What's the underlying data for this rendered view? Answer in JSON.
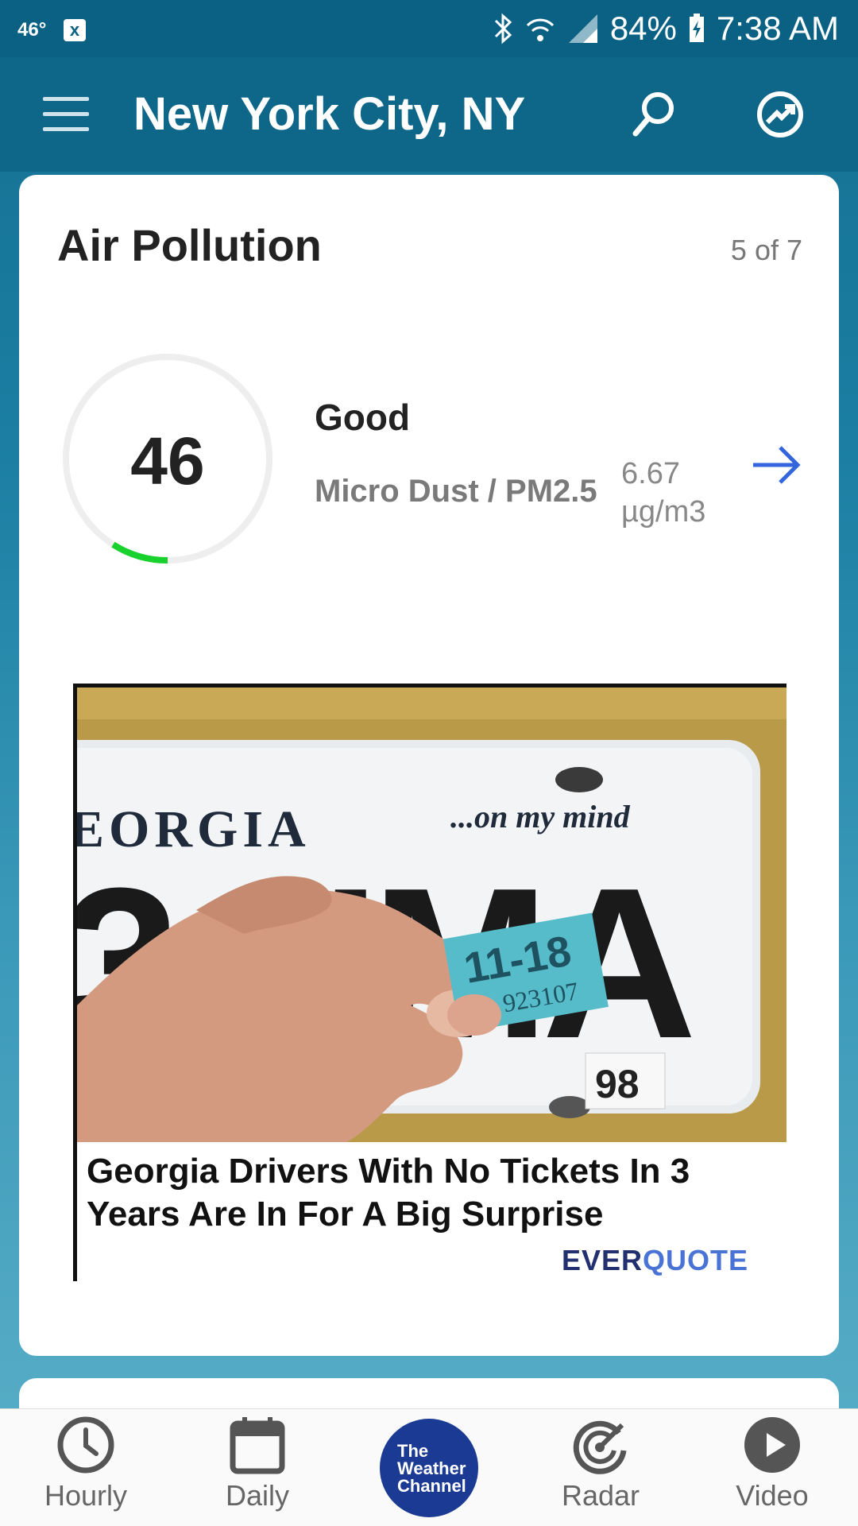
{
  "status_bar": {
    "temp": "46°",
    "notification": "x",
    "battery": "84%",
    "time": "7:38 AM"
  },
  "app_bar": {
    "city": "New York City, NY"
  },
  "card": {
    "title": "Air Pollution",
    "count": "5 of 7",
    "aqi_value": "46",
    "aqi_fraction": 0.09,
    "status": "Good",
    "pollutant": "Micro Dust / PM2.5",
    "pollutant_value": "6.67",
    "pollutant_unit": "µg/m3",
    "colors": {
      "gauge_fill": "#19d12c",
      "arrow": "#3366dd"
    }
  },
  "ad": {
    "headline": "Georgia Drivers With No Tickets In 3 Years Are In For A Big Surprise",
    "brand_part1": "EVER",
    "brand_part2": "QUOTE",
    "plate_text_top": "EORGIA",
    "plate_slogan": "...on my mind",
    "plate_number": "3 UMA",
    "sticker_date": "11-18",
    "sticker_code": "923107",
    "plate_corner": "98"
  },
  "bottom_nav": {
    "items": [
      {
        "label": "Hourly",
        "icon": "clock-icon"
      },
      {
        "label": "Daily",
        "icon": "calendar-icon"
      },
      {
        "label": "The Weather Channel",
        "icon": "twc-logo"
      },
      {
        "label": "Radar",
        "icon": "radar-icon"
      },
      {
        "label": "Video",
        "icon": "play-icon"
      }
    ],
    "logo_line1": "The",
    "logo_line2": "Weather",
    "logo_line3": "Channel"
  }
}
